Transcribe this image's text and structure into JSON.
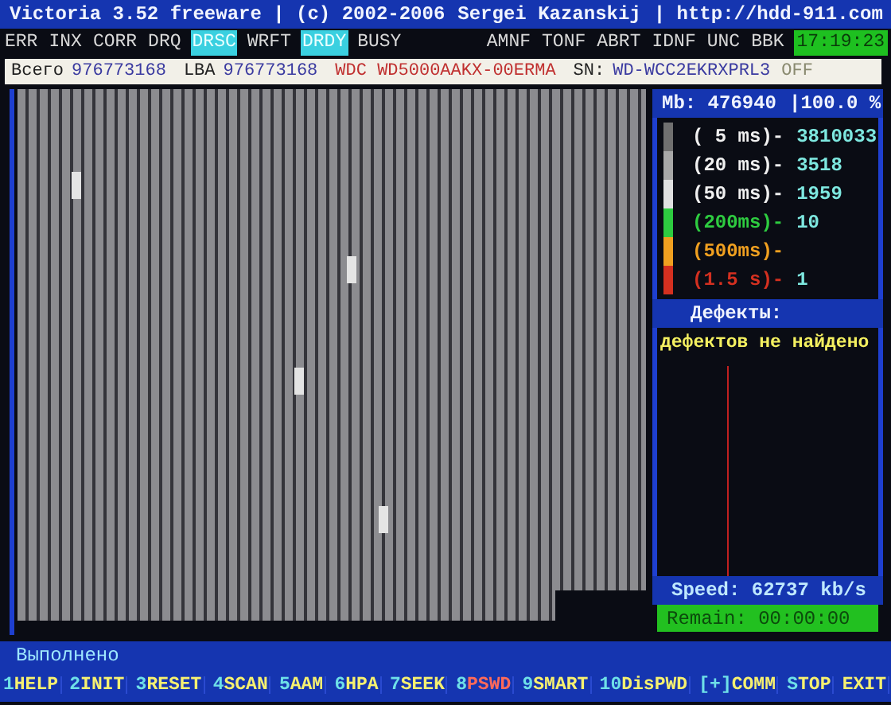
{
  "title_bar": {
    "program": "Victoria 3.52 freeware | (c) 2002-2006",
    "author": "Sergei Kazanskij",
    "url": "| http://hdd-911.com"
  },
  "status_flags_left": [
    {
      "label": "ERR",
      "on": false
    },
    {
      "label": "INX",
      "on": false
    },
    {
      "label": "CORR",
      "on": false
    },
    {
      "label": "DRQ",
      "on": false
    },
    {
      "label": "DRSC",
      "on": true
    },
    {
      "label": "WRFT",
      "on": false
    },
    {
      "label": "DRDY",
      "on": true
    },
    {
      "label": "BUSY",
      "on": false
    }
  ],
  "status_flags_right": [
    {
      "label": "AMNF",
      "on": false
    },
    {
      "label": "TONF",
      "on": false
    },
    {
      "label": "ABRT",
      "on": false
    },
    {
      "label": "IDNF",
      "on": false
    },
    {
      "label": "UNC",
      "on": false
    },
    {
      "label": "BBK",
      "on": false
    }
  ],
  "clock": "17:19:23",
  "drive_info": {
    "total_label": "Всего",
    "total": "976773168",
    "lba_label": "LBA",
    "lba": "976773168",
    "model": "WDC WD5000AAKX-00ERMA",
    "sn_label": "SN:",
    "serial": "WD-WCC2EKRXPRL3",
    "off": "OFF"
  },
  "progress": {
    "mb": "Mb: 476940",
    "percent": "|100.0 %"
  },
  "timings": [
    {
      "label": "( 5 ms)-",
      "count": "3810033",
      "color": "#707070"
    },
    {
      "label": "(20 ms)-",
      "count": "3518",
      "color": "#a8a8a8"
    },
    {
      "label": "(50 ms)-",
      "count": "1959",
      "color": "#e0e0e0"
    },
    {
      "label": "(200ms)-",
      "count": "10",
      "color": "#2ecc40"
    },
    {
      "label": "(500ms)-",
      "color": "#f0a020"
    },
    {
      "label": "(1.5 s)-",
      "count": "1",
      "color": "#d43020"
    }
  ],
  "defects": {
    "header": "Дефекты:",
    "message": "дефектов не найдено"
  },
  "speed": "Speed: 62737 kb/s",
  "remain": "Remain: 00:00:00",
  "status_message": "Выполнено",
  "function_keys": [
    {
      "key": "1",
      "label": "HELP"
    },
    {
      "key": "2",
      "label": "INIT"
    },
    {
      "key": "3",
      "label": "RESET"
    },
    {
      "key": "4",
      "label": "SCAN"
    },
    {
      "key": "5",
      "label": "AAM"
    },
    {
      "key": "6",
      "label": "HPA"
    },
    {
      "key": "7",
      "label": "SEEK"
    },
    {
      "key": "8",
      "label": "PSWD",
      "kind": "warning"
    },
    {
      "key": "9",
      "label": "SMART"
    },
    {
      "key": "10",
      "label": "DisPWD"
    },
    {
      "key": "[+]",
      "label": "COMM"
    },
    {
      "key": "S",
      "label": "TOP"
    },
    {
      "label": "EXIT"
    }
  ]
}
